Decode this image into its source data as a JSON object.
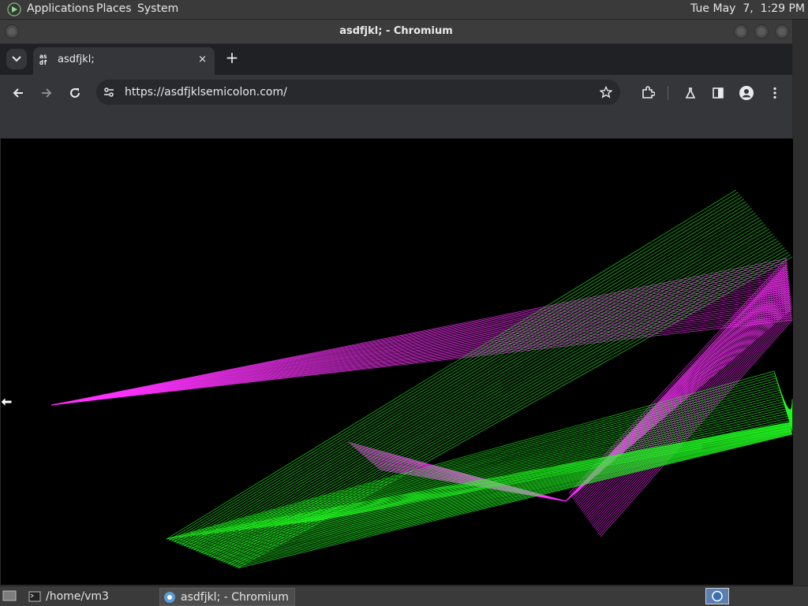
{
  "top_panel": {
    "menus": [
      "Applications",
      "Places",
      "System"
    ],
    "clock": "Tue May  7,  1:29 PM"
  },
  "window": {
    "title": "asdfjkl; - Chromium"
  },
  "browser": {
    "tab": {
      "favicon_text_top": "as",
      "favicon_text_bottom": "df",
      "title": "asdfjkl;",
      "close_glyph": "×"
    },
    "new_tab_glyph": "+",
    "address_bar": {
      "url": "https://asdfjklsemicolon.com/"
    },
    "icons": [
      "tab-search-icon",
      "back-icon",
      "forward-icon",
      "reload-icon",
      "site-info-icon",
      "bookmark-star-icon",
      "extensions-icon",
      "labs-icon",
      "side-panel-icon",
      "profile-icon",
      "menu-icon"
    ]
  },
  "page": {
    "canvas_colors": {
      "background": "#000000",
      "magenta": "#ff33ff",
      "green": "#22ff22"
    }
  },
  "taskbar": {
    "items": [
      {
        "label": "/home/vm3",
        "icon": "terminal-icon",
        "active": false
      },
      {
        "label": "asdfjkl; - Chromium",
        "icon": "chromium-icon",
        "active": true
      }
    ]
  }
}
